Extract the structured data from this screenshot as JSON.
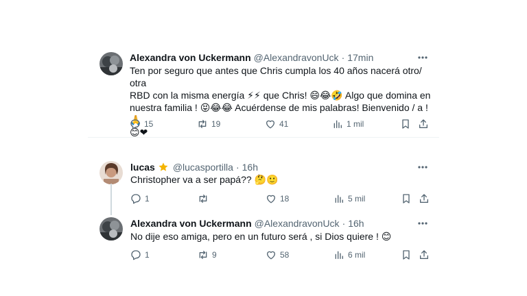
{
  "tweets": [
    {
      "author": "Alexandra von Uckermann",
      "handle": "@AlexandravonUck",
      "time": "17min",
      "lines": [
        "Ten por seguro que antes que Chris cumpla los 40 años nacerá otro/ otra",
        "RBD con la misma energía ⚡⚡ que Chris! 😄😂🤣 Algo que domina en",
        "nuestra familia ! 😝😂😂 Acuérdense de mis palabras! Bienvenido / a ! 🙏",
        "😊❤"
      ],
      "replies": "15",
      "retweets": "19",
      "likes": "41",
      "views": "1 mil"
    },
    {
      "author": "lucas",
      "handle": "@lucasportilla",
      "time": "16h",
      "lines": [
        "Christopher va a ser papá?? 🤔🙂"
      ],
      "replies": "1",
      "retweets": "",
      "likes": "18",
      "views": "5 mil"
    },
    {
      "author": "Alexandra von Uckermann",
      "handle": "@AlexandravonUck",
      "time": "16h",
      "lines": [
        "No dije eso amiga, pero en un futuro será , si Dios quiere ! 😊"
      ],
      "replies": "1",
      "retweets": "9",
      "likes": "58",
      "views": "6 mil"
    }
  ],
  "icons": {
    "reply": "reply-icon",
    "retweet": "retweet-icon",
    "like": "heart-icon",
    "views": "views-icon",
    "bookmark": "bookmark-icon",
    "share": "share-icon",
    "more": "more-icon",
    "badge": "star-badge-icon"
  },
  "colors": {
    "text": "#0f1419",
    "secondary": "#536471",
    "divider": "#eff3f4",
    "star": "#f4b400"
  }
}
